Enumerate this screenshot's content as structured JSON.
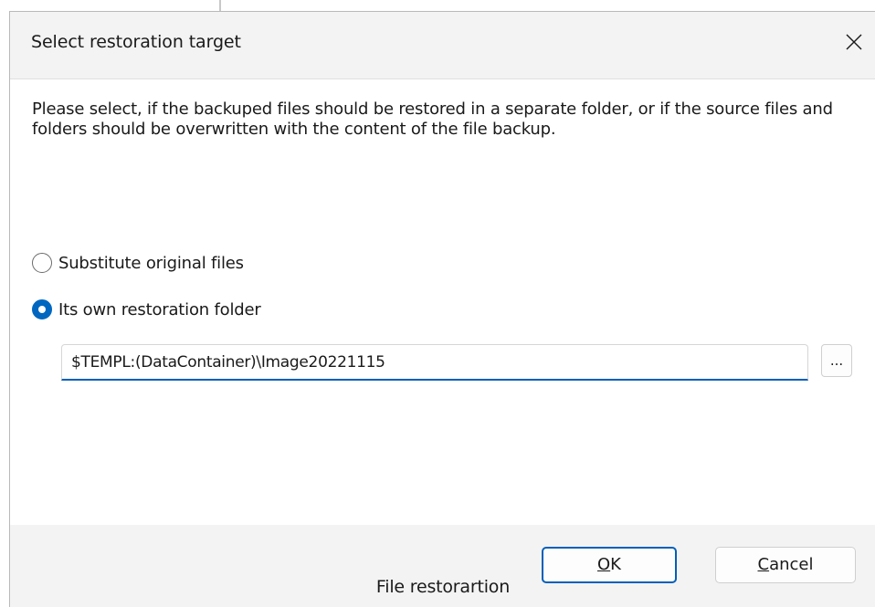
{
  "dialog": {
    "title": "Select restoration target",
    "close_icon": "close-icon",
    "description": "Please select, if the backuped files should be restored in a separate folder, or if the source files and folders should be overwritten with the content of the file backup."
  },
  "options": {
    "substitute": {
      "label": "Substitute original files",
      "selected": false
    },
    "own_folder": {
      "label": "Its own restoration folder",
      "selected": true
    }
  },
  "path": {
    "value": "$TEMPL:(DataContainer)\\Image20221115",
    "browse_label": "..."
  },
  "buttons": {
    "ok_accel": "O",
    "ok_rest": "K",
    "cancel_accel": "C",
    "cancel_rest": "ancel"
  },
  "caption": "File restorartion",
  "colors": {
    "accent": "#005fb8",
    "titlebar_bg": "#f3f3f3",
    "footer_bg": "#f3f3f3"
  }
}
